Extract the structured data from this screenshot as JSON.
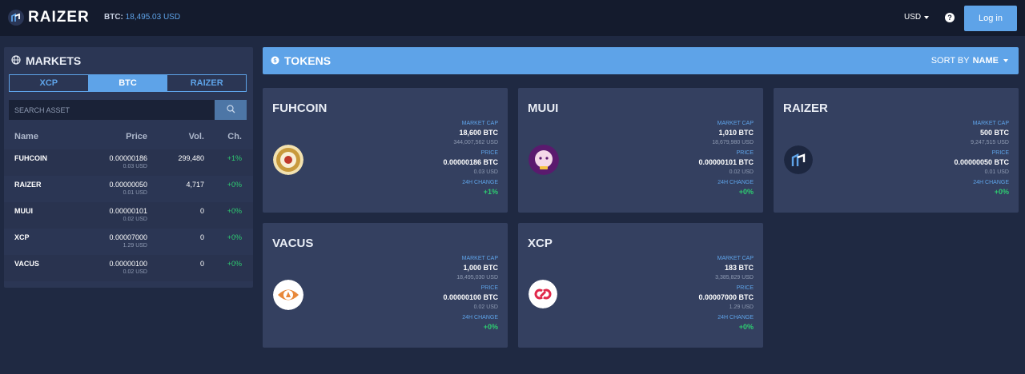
{
  "header": {
    "brand": "RAIZER",
    "btc_label": "BTC:",
    "btc_value": "18,495.03 USD",
    "currency": "USD",
    "help": "?",
    "login": "Log in"
  },
  "markets": {
    "title": "MARKETS",
    "tabs": [
      {
        "label": "XCP",
        "active": false
      },
      {
        "label": "BTC",
        "active": true
      },
      {
        "label": "RAIZER",
        "active": false
      }
    ],
    "search_placeholder": "SEARCH ASSET",
    "columns": {
      "name": "Name",
      "price": "Price",
      "vol": "Vol.",
      "ch": "Ch."
    },
    "rows": [
      {
        "name": "FUHCOIN",
        "price": "0.00000186",
        "usd": "0.03 USD",
        "vol": "299,480",
        "ch": "+1%"
      },
      {
        "name": "RAIZER",
        "price": "0.00000050",
        "usd": "0.01 USD",
        "vol": "4,717",
        "ch": "+0%"
      },
      {
        "name": "MUUI",
        "price": "0.00000101",
        "usd": "0.02 USD",
        "vol": "0",
        "ch": "+0%"
      },
      {
        "name": "XCP",
        "price": "0.00007000",
        "usd": "1.29 USD",
        "vol": "0",
        "ch": "+0%"
      },
      {
        "name": "VACUS",
        "price": "0.00000100",
        "usd": "0.02 USD",
        "vol": "0",
        "ch": "+0%"
      }
    ]
  },
  "tokens": {
    "title": "TOKENS",
    "sort_prefix": "SORT BY",
    "sort_value": "NAME",
    "labels": {
      "market_cap": "MARKET CAP",
      "price": "PRICE",
      "change": "24H CHANGE"
    },
    "cards": [
      {
        "name": "FUHCOIN",
        "icon": "fuhcoin-logo-icon",
        "market_cap": "18,600 BTC",
        "market_cap_usd": "344,007,562 USD",
        "price": "0.00000186 BTC",
        "price_usd": "0.03 USD",
        "change": "+1%"
      },
      {
        "name": "MUUI",
        "icon": "muui-logo-icon",
        "market_cap": "1,010 BTC",
        "market_cap_usd": "18,679,980 USD",
        "price": "0.00000101 BTC",
        "price_usd": "0.02 USD",
        "change": "+0%"
      },
      {
        "name": "RAIZER",
        "icon": "raizer-logo-icon",
        "market_cap": "500 BTC",
        "market_cap_usd": "9,247,515 USD",
        "price": "0.00000050 BTC",
        "price_usd": "0.01 USD",
        "change": "+0%"
      },
      {
        "name": "VACUS",
        "icon": "vacus-logo-icon",
        "market_cap": "1,000 BTC",
        "market_cap_usd": "18,495,030 USD",
        "price": "0.00000100 BTC",
        "price_usd": "0.02 USD",
        "change": "+0%"
      },
      {
        "name": "XCP",
        "icon": "xcp-logo-icon",
        "market_cap": "183 BTC",
        "market_cap_usd": "3,385,829 USD",
        "price": "0.00007000 BTC",
        "price_usd": "1.29 USD",
        "change": "+0%"
      }
    ]
  },
  "colors": {
    "accent": "#5ea3e8",
    "positive": "#2ecc71",
    "panel": "#2b3654",
    "background": "#1f2942"
  }
}
